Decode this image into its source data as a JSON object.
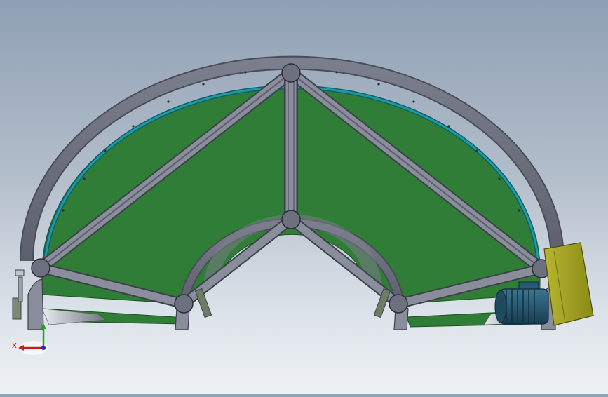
{
  "viewport": {
    "background_top": "#8fa0b4",
    "background_bottom": "#eef2f5"
  },
  "model": {
    "belt_color": "#2f7d36",
    "frame_color": "#6d707e",
    "guide_color": "#1d9aa3",
    "motor_color": "#2a5a73",
    "gearbox_color": "#9a9a1e"
  },
  "triad": {
    "x_label": "X",
    "y_label": "Y",
    "x_color": "#c81c1c",
    "y_color": "#1ea61e",
    "z_color": "#1c2bd0"
  }
}
